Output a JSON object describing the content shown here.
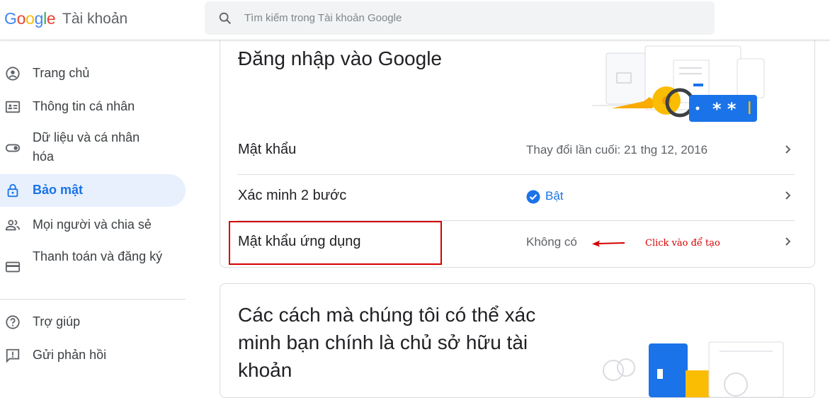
{
  "header": {
    "logo_text": "Google",
    "product_name": "Tài khoản",
    "search_placeholder": "Tìm kiếm trong Tài khoản Google"
  },
  "sidebar": {
    "items": [
      {
        "label": "Trang chủ",
        "icon": "account-circle-icon",
        "active": false
      },
      {
        "label": "Thông tin cá nhân",
        "icon": "id-card-icon",
        "active": false
      },
      {
        "label": "Dữ liệu và cá nhân hóa",
        "icon": "toggle-icon",
        "active": false
      },
      {
        "label": "Bảo mật",
        "icon": "lock-icon",
        "active": true
      },
      {
        "label": "Mọi người và chia sẻ",
        "icon": "people-icon",
        "active": false
      },
      {
        "label": "Thanh toán và đăng ký",
        "icon": "credit-card-icon",
        "active": false
      }
    ],
    "footer_items": [
      {
        "label": "Trợ giúp",
        "icon": "help-icon"
      },
      {
        "label": "Gửi phản hồi",
        "icon": "feedback-icon"
      }
    ]
  },
  "signin_card": {
    "title": "Đăng nhập vào Google",
    "rows": [
      {
        "label": "Mật khẩu",
        "value": "Thay đổi lần cuối: 21 thg 12, 2016"
      },
      {
        "label": "Xác minh 2 bước",
        "value": "Bật"
      },
      {
        "label": "Mật khẩu ứng dụng",
        "value": "Không có"
      }
    ],
    "annotation": "Click vào để tạo"
  },
  "verify_card": {
    "title": "Các cách mà chúng tôi có thể xác minh bạn chính là chủ sở hữu tài khoản"
  },
  "colors": {
    "accent": "#1a73e8",
    "active_bg": "#e8f0fe",
    "annotation_red": "#d50000"
  }
}
